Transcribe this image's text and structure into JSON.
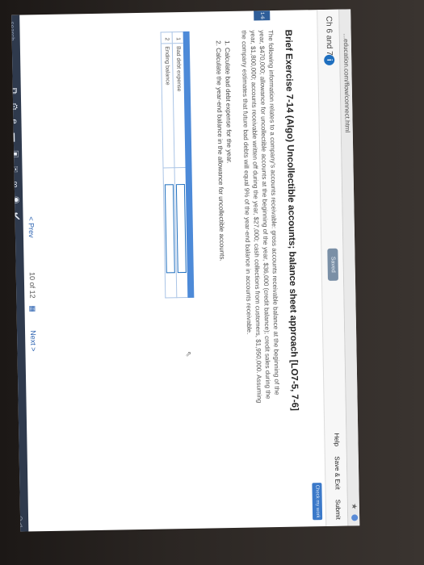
{
  "browser": {
    "url": "...education.com/flow/connect.html"
  },
  "header": {
    "chapter": "Ch 6 and 7",
    "info_glyph": "i",
    "saved_label": "Saved",
    "links": [
      "Help",
      "Save & Exit",
      "Submit"
    ]
  },
  "check_button": "Check my work",
  "question_tab": "1-6",
  "exercise": {
    "title": "Brief Exercise 7-14 (Algo) Uncollectible accounts; balance sheet approach [LO7-5, 7-6]",
    "paragraph": "The following information relates to a company's accounts receivable: gross accounts receivable balance at the beginning of the year, $470,000; allowance for uncollectible accounts at the beginning of the year, $36,000 (credit balance); credit sales during the year, $1,800,000; accounts receivable written off during the year, $27,000; cash collections from customers, $1,950,000. Assuming the company estimates that future bad debts will equal 9% of the year-end balance in accounts receivable.",
    "tasks": [
      "1. Calculate bad debt expense for the year.",
      "2. Calculate the year-end balance in the allowance for uncollectible accounts."
    ]
  },
  "answer_table": {
    "rows": [
      {
        "num": "1",
        "label": "Bad debt expense",
        "value": ""
      },
      {
        "num": "2",
        "label": "Ending balance",
        "value": ""
      }
    ]
  },
  "pager": {
    "prev": "< Prev",
    "count": "10 of 12",
    "next": "Next >"
  },
  "taskbar": {
    "search": "search"
  },
  "colors": {
    "accent": "#1f6fbf",
    "table_header": "#4d8ad8",
    "taskbar": "#2f3a4d"
  }
}
